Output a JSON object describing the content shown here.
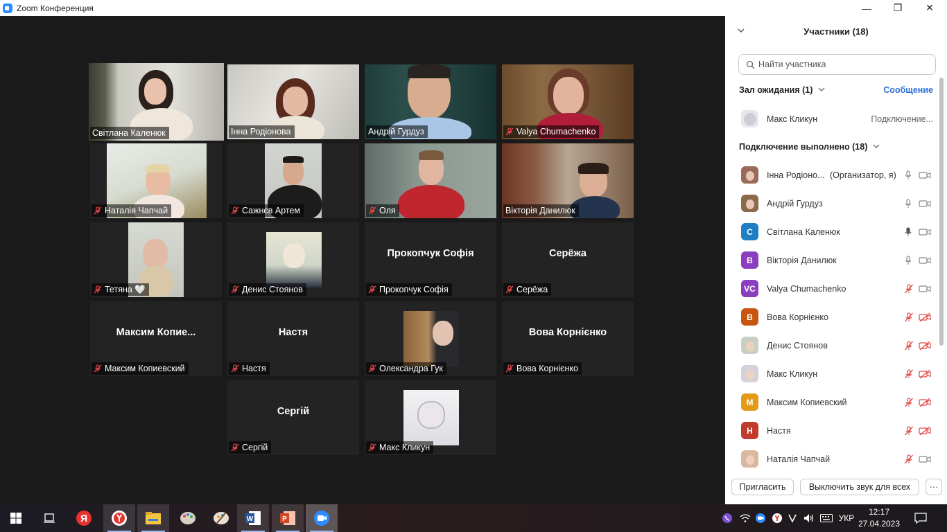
{
  "window": {
    "title": "Zoom Конференция",
    "minimize": "—",
    "maximize": "❐",
    "close": "✕"
  },
  "tiles": [
    {
      "name": "Світлана Каленюк",
      "muted": false
    },
    {
      "name": "Інна Родіонова",
      "muted": false
    },
    {
      "name": "Андрій Гурдуз",
      "muted": false
    },
    {
      "name": "Valya Chumachenko",
      "muted": true
    },
    {
      "name": "Наталія Чапчай",
      "muted": true
    },
    {
      "name": "Сажнєв Артем",
      "muted": true
    },
    {
      "name": "Оля",
      "muted": true
    },
    {
      "name": "Вікторія Данилюк",
      "muted": false
    },
    {
      "name": "Тетяна 🤍",
      "muted": true
    },
    {
      "name": "Денис Стоянов",
      "muted": true
    },
    {
      "name": "Прокопчук Софія",
      "center": "Прокопчук  Софія",
      "muted": true
    },
    {
      "name": "Серёжа",
      "center": "Серёжа",
      "muted": true
    },
    {
      "name": "Максим Копиевский",
      "center": "Максим  Копие...",
      "muted": true
    },
    {
      "name": "Настя",
      "center": "Настя",
      "muted": true
    },
    {
      "name": "Олександра Гук",
      "muted": true
    },
    {
      "name": "Вова Корнієнко",
      "center": "Вова Корнієнко",
      "muted": true
    },
    {
      "name": "Сергій",
      "center": "Сергій",
      "muted": true
    },
    {
      "name": "Макс Кликун",
      "muted": true
    }
  ],
  "panel": {
    "title": "Участники (18)",
    "search_placeholder": "Найти участника",
    "waiting_label": "Зал ожидания (1)",
    "message_link": "Сообщение",
    "waiting": [
      {
        "name": "Макс Кликун",
        "status": "Подключение..."
      }
    ],
    "connected_label": "Подключение выполнено (18)",
    "participants": [
      {
        "name": "Інна Родіоно...",
        "role": "(Организатор, я)",
        "avatar": "photo",
        "mic": "on",
        "cam": "off"
      },
      {
        "name": "Андрій Гурдуз",
        "avatar": "photo",
        "mic": "on",
        "cam": "off"
      },
      {
        "name": "Світлана Каленюк",
        "avatar": "С",
        "color": "#1e7fc4",
        "mic": "active",
        "cam": "off"
      },
      {
        "name": "Вікторія Данилюк",
        "avatar": "В",
        "color": "#8b3fbf",
        "mic": "on",
        "cam": "off"
      },
      {
        "name": "Valya Chumachenko",
        "avatar": "VC",
        "color": "#8b3fbf",
        "mic": "muted",
        "cam": "off"
      },
      {
        "name": "Вова Корнієнко",
        "avatar": "В",
        "color": "#c9560f",
        "mic": "muted",
        "cam": "muted"
      },
      {
        "name": "Денис Стоянов",
        "avatar": "photo",
        "mic": "muted",
        "cam": "muted"
      },
      {
        "name": "Макс Кликун",
        "avatar": "photo",
        "mic": "muted",
        "cam": "muted"
      },
      {
        "name": "Максим Копиевский",
        "avatar": "М",
        "color": "#e39a18",
        "mic": "muted",
        "cam": "muted"
      },
      {
        "name": "Настя",
        "avatar": "Н",
        "color": "#c23a2b",
        "mic": "muted",
        "cam": "muted"
      },
      {
        "name": "Наталія Чапчай",
        "avatar": "photo",
        "mic": "muted",
        "cam": "off"
      }
    ],
    "invite_button": "Пригласить",
    "mute_all_button": "Выключить звук для всех",
    "more_button": "···"
  },
  "taskbar": {
    "language": "УКР",
    "time": "12:17",
    "date": "27.04.2023"
  }
}
